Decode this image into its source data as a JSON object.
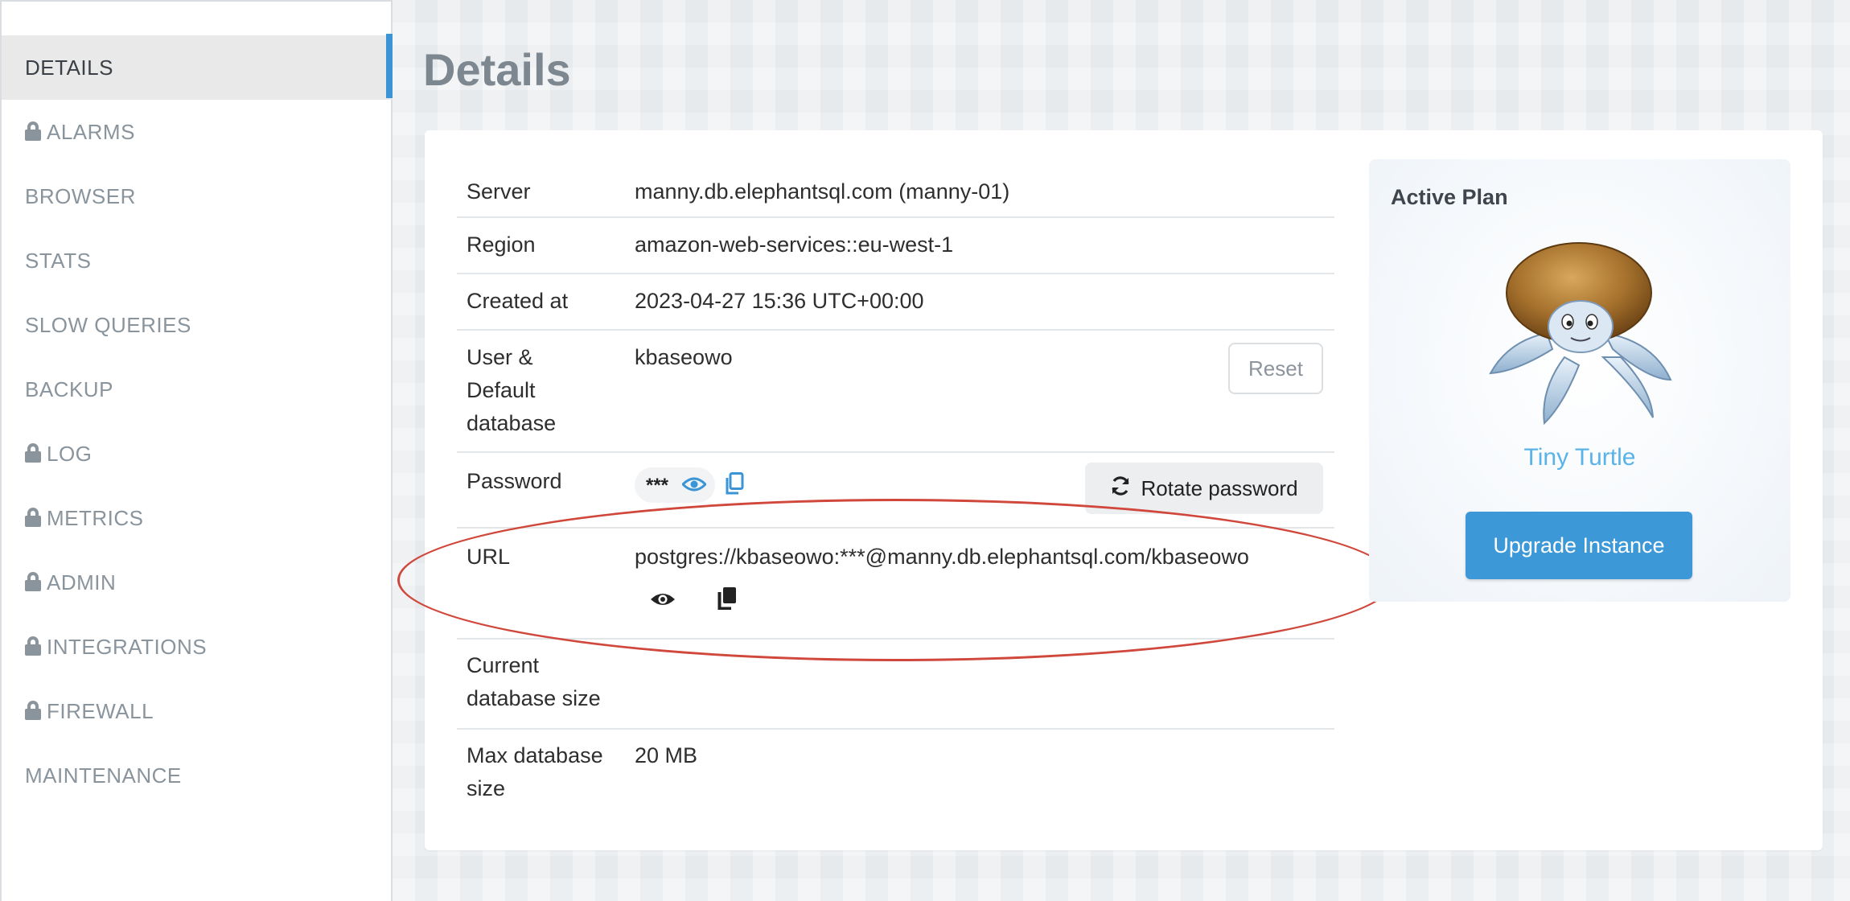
{
  "sidebar": {
    "items": [
      {
        "label": "DETAILS",
        "locked": false,
        "active": true
      },
      {
        "label": "ALARMS",
        "locked": true
      },
      {
        "label": "BROWSER",
        "locked": false
      },
      {
        "label": "STATS",
        "locked": false
      },
      {
        "label": "SLOW QUERIES",
        "locked": false
      },
      {
        "label": "BACKUP",
        "locked": false
      },
      {
        "label": "LOG",
        "locked": true
      },
      {
        "label": "METRICS",
        "locked": true
      },
      {
        "label": "ADMIN",
        "locked": true
      },
      {
        "label": "INTEGRATIONS",
        "locked": true
      },
      {
        "label": "FIREWALL",
        "locked": true
      },
      {
        "label": "MAINTENANCE",
        "locked": false
      }
    ]
  },
  "page": {
    "title": "Details"
  },
  "details": {
    "server": {
      "label": "Server",
      "value": "manny.db.elephantsql.com (manny-01)"
    },
    "region": {
      "label": "Region",
      "value": "amazon-web-services::eu-west-1"
    },
    "created": {
      "label": "Created at",
      "value": "2023-04-27 15:36 UTC+00:00"
    },
    "user": {
      "label_lines": [
        "User &",
        "Default",
        "database"
      ],
      "value": "kbaseowo",
      "reset_label": "Reset"
    },
    "password": {
      "label": "Password",
      "masked": "***",
      "rotate_label": "Rotate password"
    },
    "url": {
      "label": "URL",
      "value": "postgres://kbaseowo:***@manny.db.elephantsql.com/kbaseowo"
    },
    "current_size": {
      "label_lines": [
        "Current",
        "database size"
      ],
      "value": ""
    },
    "max_size": {
      "label_lines": [
        "Max database",
        "size"
      ],
      "value": "20 MB"
    }
  },
  "plan": {
    "heading": "Active Plan",
    "name": "Tiny Turtle",
    "upgrade_label": "Upgrade Instance"
  },
  "colors": {
    "accent": "#3a94d6",
    "plan_name": "#59b3e8",
    "upgrade_button": "#3d98d8",
    "annotation_oval": "#d0473b"
  }
}
